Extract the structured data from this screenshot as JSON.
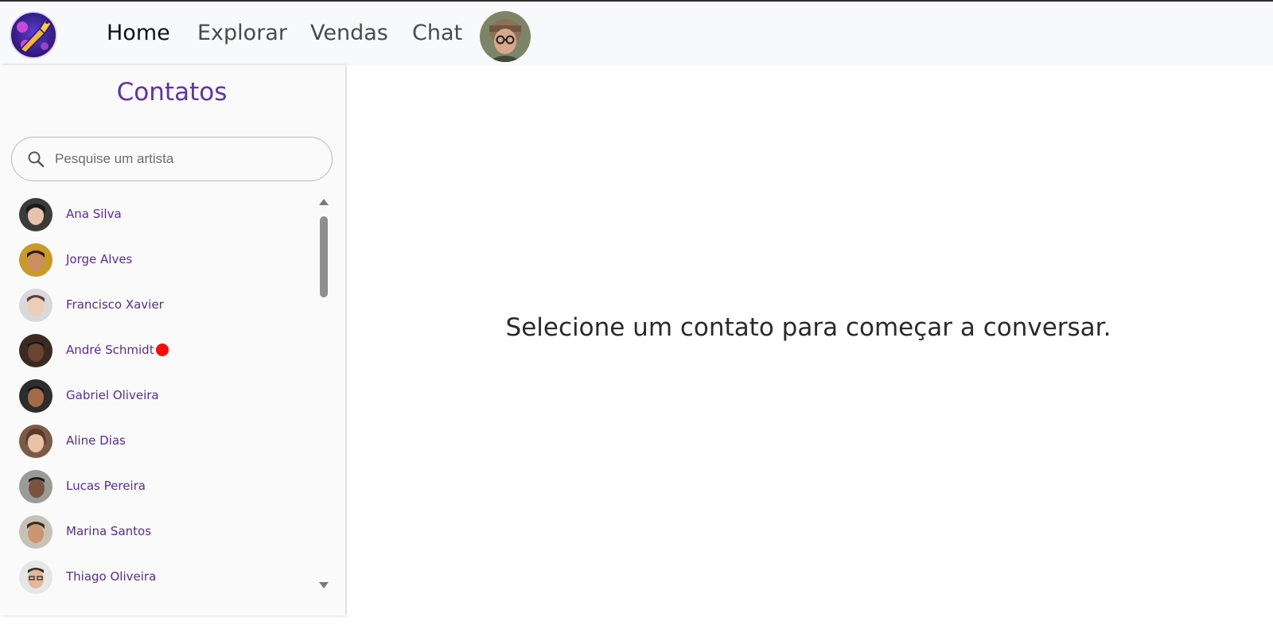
{
  "header": {
    "logo_icon": "paintbrush-palette-logo-icon",
    "nav": [
      {
        "label": "Home",
        "active": true
      },
      {
        "label": "Explorar",
        "active": false
      },
      {
        "label": "Vendas",
        "active": false
      },
      {
        "label": "Chat",
        "active": false
      }
    ],
    "profile_avatar_icon": "user-avatar-icon"
  },
  "sidebar": {
    "title": "Contatos",
    "search": {
      "placeholder": "Pesquise um artista",
      "value": "",
      "icon": "search-icon"
    },
    "contacts": [
      {
        "name": "Ana Silva",
        "unread": false
      },
      {
        "name": "Jorge Alves",
        "unread": false
      },
      {
        "name": "Francisco Xavier",
        "unread": false
      },
      {
        "name": "André Schmidt",
        "unread": true
      },
      {
        "name": "Gabriel Oliveira",
        "unread": false
      },
      {
        "name": "Aline Dias",
        "unread": false
      },
      {
        "name": "Lucas Pereira",
        "unread": false
      },
      {
        "name": "Marina Santos",
        "unread": false
      },
      {
        "name": "Thiago Oliveira",
        "unread": false
      }
    ]
  },
  "main": {
    "empty_message": "Selecione um contato para começar a conversar."
  },
  "colors": {
    "accent_purple": "#6232a8",
    "unread_red": "#ff0a0a",
    "topbar_bg": "#f8f9fb",
    "sidebar_bg": "#fafafa"
  }
}
